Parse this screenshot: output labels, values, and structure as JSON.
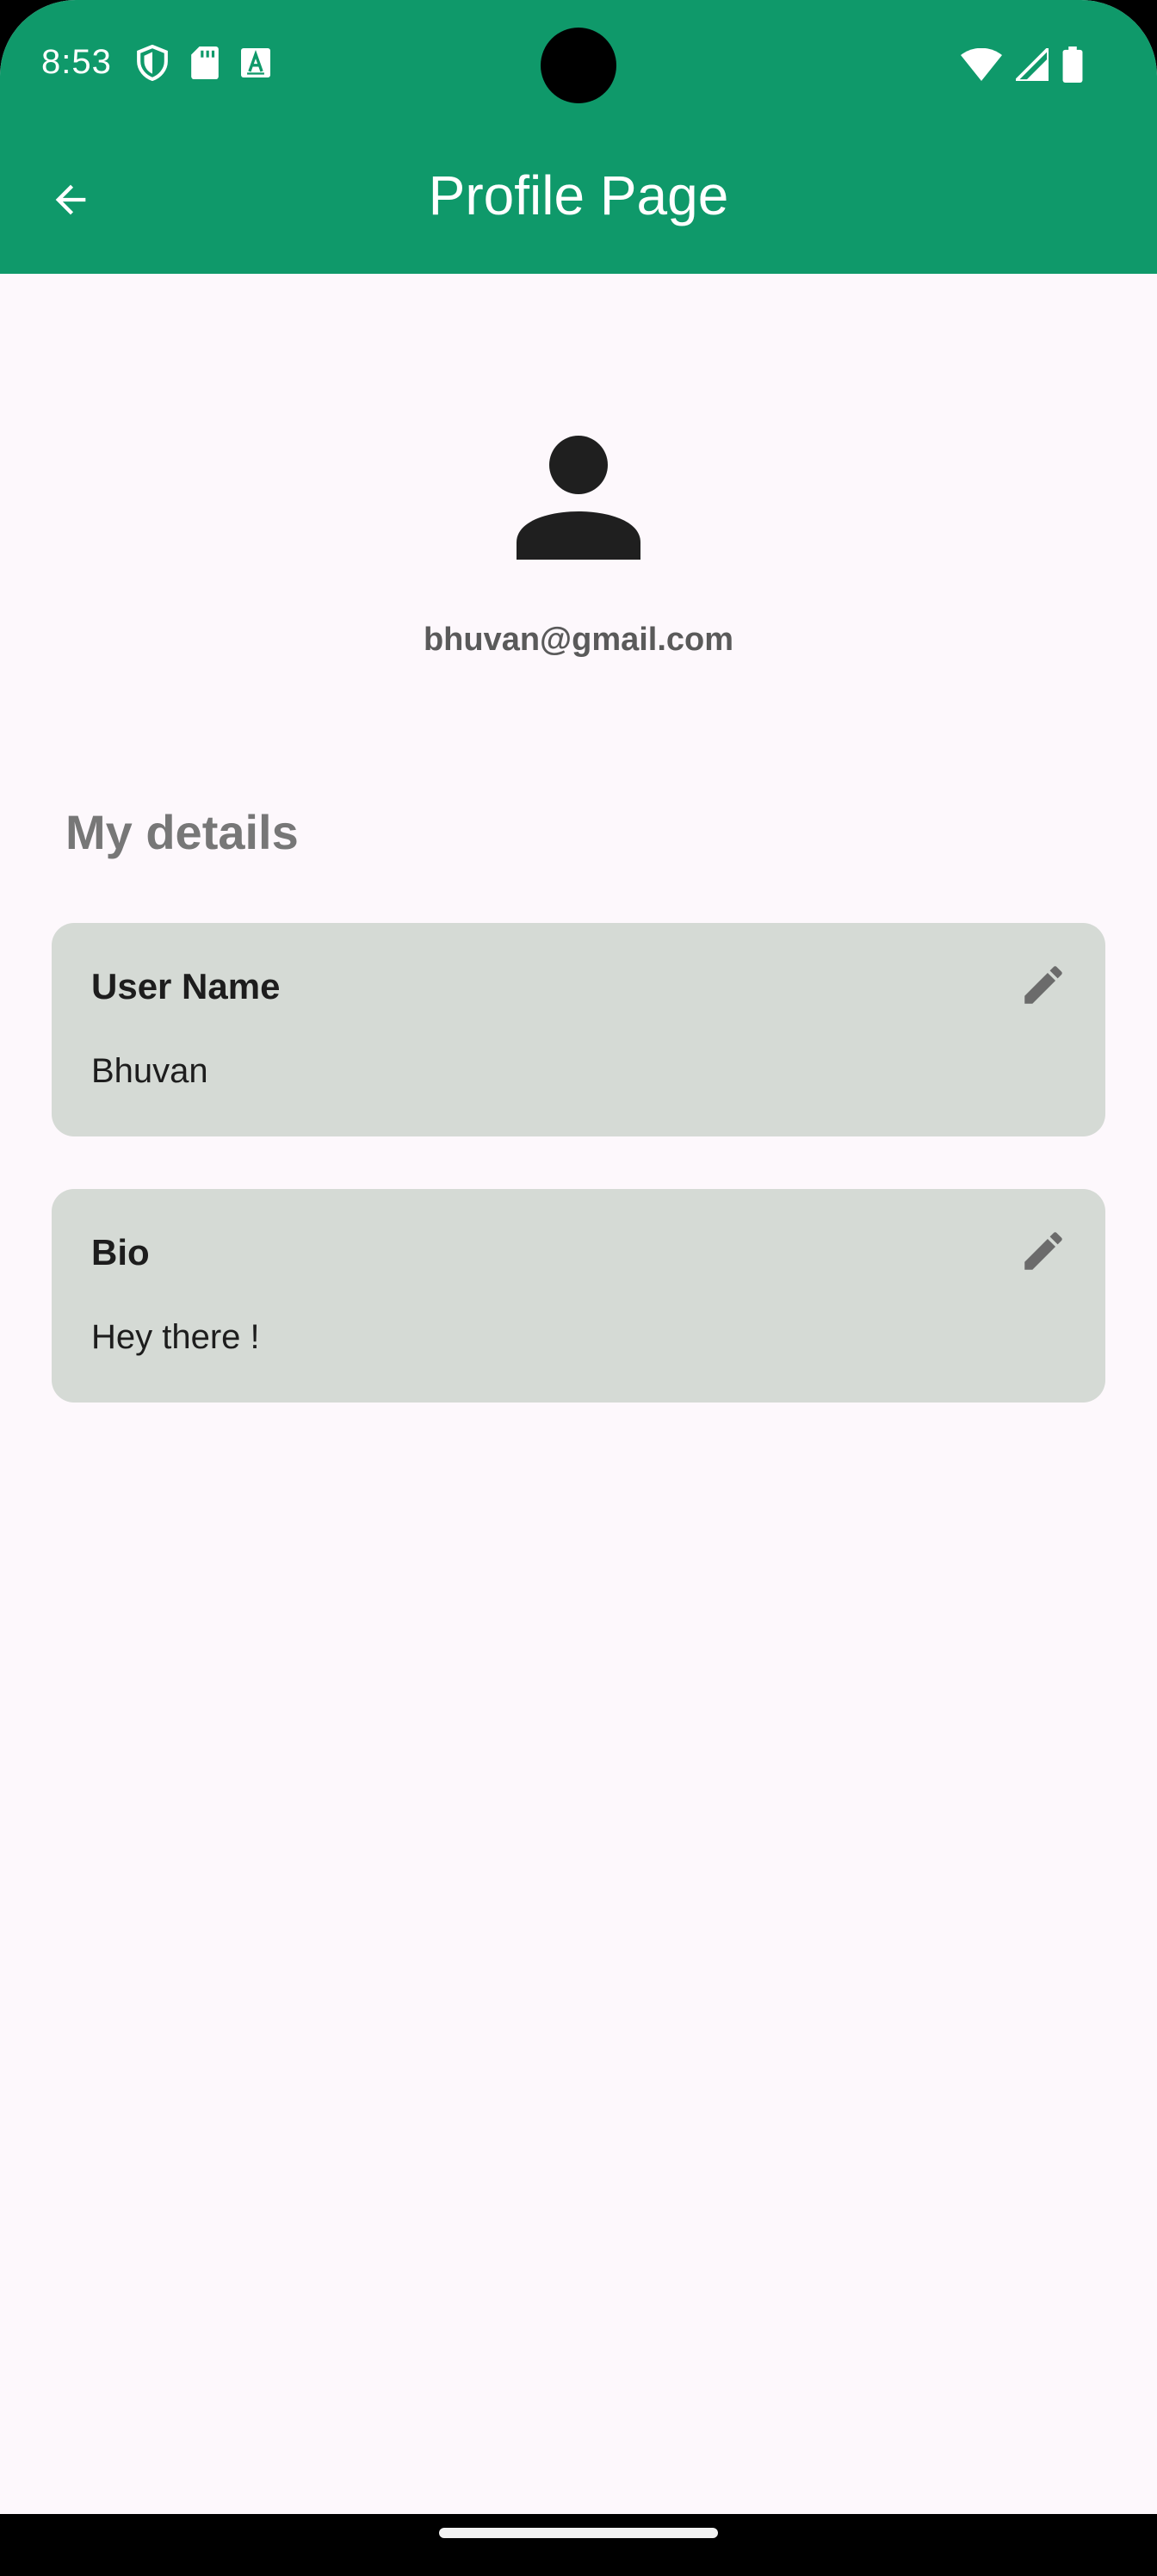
{
  "status_bar": {
    "time": "8:53",
    "left_icons": [
      "shield-icon",
      "sd-card-icon",
      "keyboard-a-icon"
    ],
    "right_icons": [
      "wifi-icon",
      "cellular-signal-icon",
      "battery-icon"
    ]
  },
  "app_bar": {
    "title": "Profile Page",
    "back_icon": "arrow-back-icon",
    "background_color": "#0f996a"
  },
  "profile": {
    "avatar_icon": "person-icon",
    "email": "bhuvan@gmail.com"
  },
  "details": {
    "section_title": "My details",
    "cards": [
      {
        "label": "User Name",
        "value": "Bhuvan",
        "action_icon": "edit-pencil-icon"
      },
      {
        "label": "Bio",
        "value": "Hey there !",
        "action_icon": "edit-pencil-icon"
      }
    ],
    "card_color": "#d5dad5"
  },
  "colors": {
    "accent": "#0f996a",
    "page_background": "#fdf8fc",
    "muted_text": "#777777"
  }
}
